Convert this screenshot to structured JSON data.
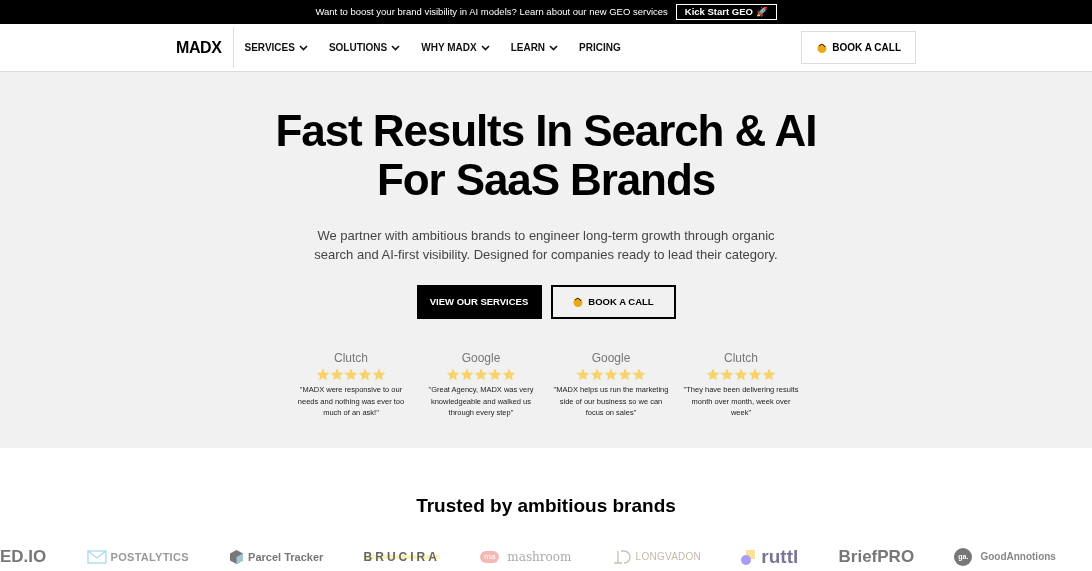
{
  "announcement": {
    "text": "Want to boost your brand visibility in AI models? Learn about our new GEO services",
    "button": "Kick Start GEO 🚀"
  },
  "nav": {
    "logo": "MADX",
    "items": [
      {
        "label": "SERVICES",
        "has_menu": true
      },
      {
        "label": "SOLUTIONS",
        "has_menu": true
      },
      {
        "label": "WHY MADX",
        "has_menu": true
      },
      {
        "label": "LEARN",
        "has_menu": true
      },
      {
        "label": "PRICING",
        "has_menu": false
      }
    ],
    "cta": "BOOK A CALL"
  },
  "hero": {
    "title_lines": [
      "Fast Results In Search & AI",
      "For SaaS Brands"
    ],
    "subtitle": "We partner with ambitious brands to engineer long-term growth through organic search and AI-first visibility. Designed for companies ready to lead their category.",
    "buttons": [
      {
        "label": "VIEW OUR SERVICES",
        "kind": "primary"
      },
      {
        "label": "BOOK A CALL",
        "kind": "secondary"
      }
    ],
    "reviews": [
      {
        "source": "Clutch",
        "stars": 5,
        "quote": "\"MADX were responsive to our needs and nothing was ever too much of an ask!\""
      },
      {
        "source": "Google",
        "stars": 5,
        "quote": "\"Great Agency, MADX was very knowledgeable and walked us through every step\""
      },
      {
        "source": "Google",
        "stars": 5,
        "quote": "\"MADX helps us run the marketing side of our business so we can focus on sales\""
      },
      {
        "source": "Clutch",
        "stars": 5,
        "quote": "\"They have been delivering results month over month, week over week\""
      }
    ]
  },
  "trusted": {
    "title": "Trusted by ambitious brands",
    "logos": [
      {
        "name": "ED.IO",
        "kind": "plain"
      },
      {
        "name": "POSTALYTICS",
        "kind": "envelope"
      },
      {
        "name": "Parcel Tracker",
        "kind": "box"
      },
      {
        "name": "BRUCIRA",
        "kind": "highlight"
      },
      {
        "name": "mashroom",
        "kind": "badge",
        "badge": "ma"
      },
      {
        "name": "LONGVADON",
        "kind": "monogram"
      },
      {
        "name": "ruttl",
        "kind": "shapes"
      },
      {
        "name": "BriefPRO",
        "kind": "plain"
      },
      {
        "name": "GoodAnnotions",
        "kind": "circle",
        "badge": "ga."
      }
    ]
  }
}
